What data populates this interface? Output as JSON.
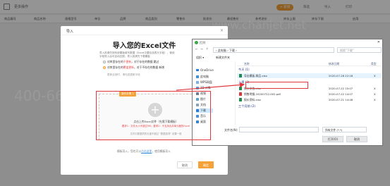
{
  "app": {
    "title": "更多操作",
    "new_button": "+ 新增",
    "toolbar": [
      "筛选",
      "导入",
      "打印"
    ],
    "columns": [
      "商品编号",
      "商品名称",
      "规格型号",
      "单位",
      "品牌",
      "商品类别",
      "零售价",
      "批发价",
      "最低售价",
      "参考进价",
      "库存上限",
      "库存下限",
      "启用"
    ]
  },
  "watermarks": [
    "400-665-0028",
    "www.chanjet.net"
  ],
  "import_dialog": {
    "title": "导入",
    "heading": "导入您的Excel文件",
    "subtitle_line1": "导入前请先按系统模板填写数据（Excel中要包含表头字段），使用",
    "subtitle_line2": "字段导入后可自动匹配，导入前请先下载模板",
    "options": [
      {
        "pre": "对库里存在的 ",
        "red": "不更新",
        "post": "，对于存在的数据 跳过"
      },
      {
        "pre": "对库里存在的 ",
        "red": "覆盖更新",
        "post": "，对于不存在的数据 新增"
      }
    ],
    "link_text": "更新全部时，请勾选更新字段",
    "tag": "操作步骤 1",
    "upload_primary": "点击上传Excel文件（先需下载模板）",
    "upload_red": "要求1：文件大小不超过5M；要求2：不支持合并单元格的Excel",
    "upload_gray": "文件中数据项的长度不超过 \"数据选项\" 设置一致",
    "footer_prefix": "模板导入，您也可以",
    "footer_link": "点击这里",
    "footer_suffix": "，使用模板导入",
    "cancel": "取消",
    "ok": "确定"
  },
  "file_dialog": {
    "title": "打开",
    "address": "› 此电脑 › 下载 ›",
    "search_placeholder": "搜索\"下载\"",
    "organize": "组织 ▾",
    "new_folder": "新建文件夹",
    "nav": [
      "OneDrive",
      "此电脑",
      "WPS网盘",
      "3D 对象",
      "视频",
      "图片",
      "文档",
      "下载",
      "音乐",
      "桌面"
    ],
    "headers": [
      "名称",
      "修改日期",
      "类型"
    ],
    "groups": [
      "今天 (1)",
      "上周 (3)",
      "三个月前 (2)"
    ],
    "files": [
      {
        "name": "导出模板-商品.xlsx",
        "date": "2020-07-28 22:18",
        "type": "X",
        "icon": "excel"
      },
      {
        "name": "报价文档.xlsx",
        "date": "2020-07-22 15:07",
        "type": "X",
        "icon": "excel"
      },
      {
        "name": "销售明细-20200722-002.pdf",
        "date": "2020-07-22 14:07",
        "type": "X",
        "icon": "pdf"
      },
      {
        "name": "报价资料.xlsx",
        "date": "2020-07-21 14:48",
        "type": "X",
        "icon": "excel"
      }
    ],
    "filename_label": "文件名(N):",
    "filetype": "所有文件 (*.*)",
    "open": "打开(O)",
    "cancel": "取消"
  },
  "colors": {
    "accent": "#f5a23a",
    "highlight": "#e0363d",
    "link": "#3b8bd6",
    "excel": "#1f8a4c",
    "pdf": "#d9363e"
  }
}
